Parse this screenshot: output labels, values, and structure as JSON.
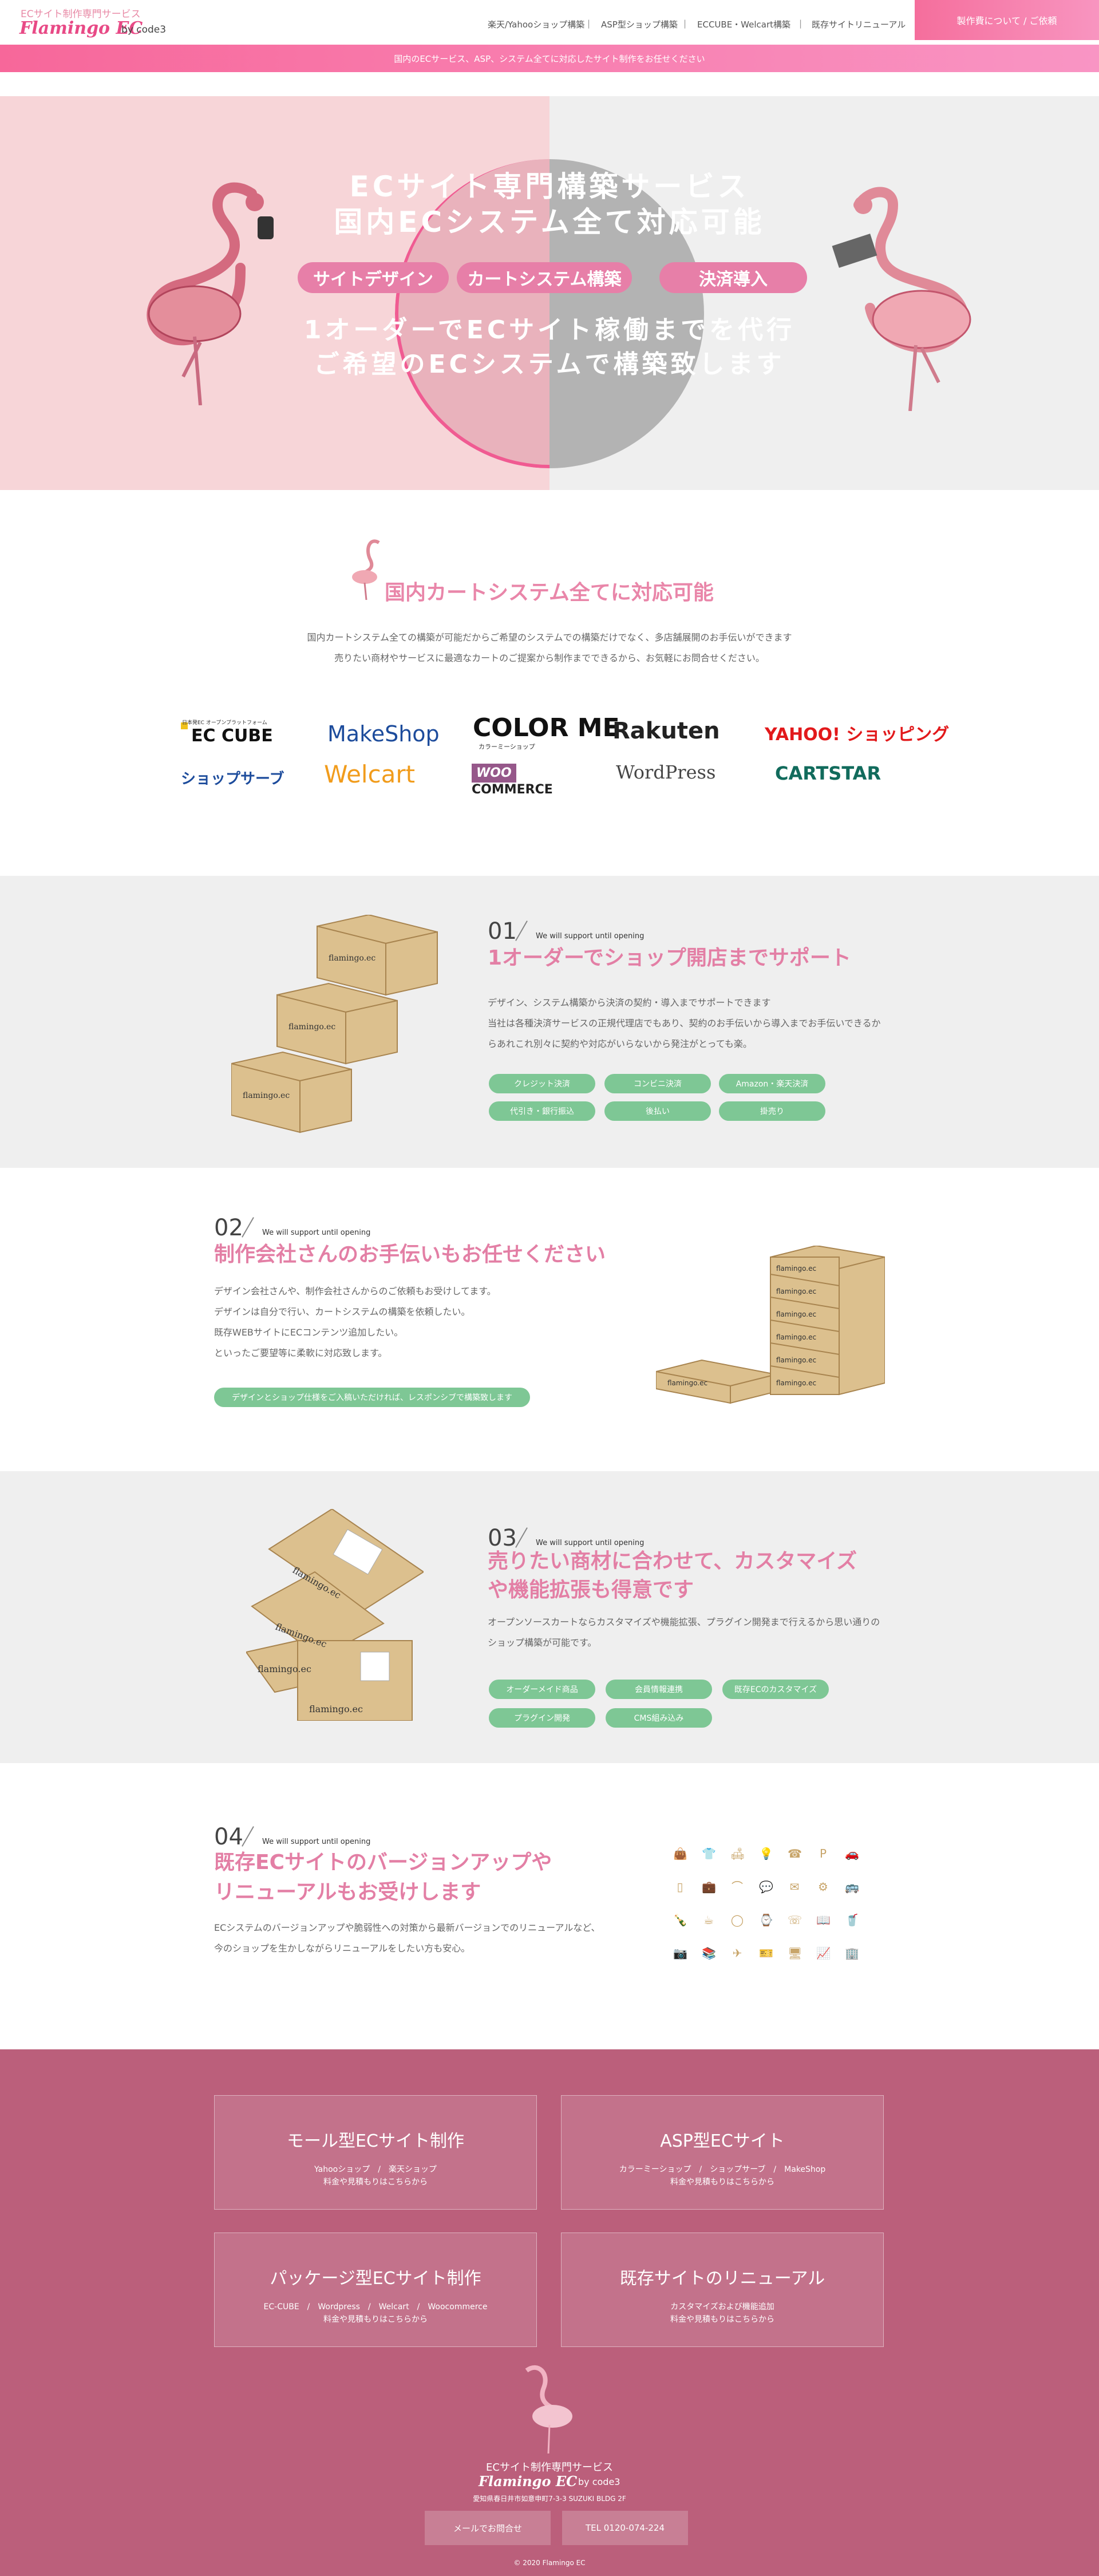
{
  "header": {
    "logo_sub": "ECサイト制作専門サービス",
    "logo_main": "Flamingo EC",
    "logo_by": "by code3",
    "nav": [
      "楽天/Yahooショップ構築",
      "ASP型ショップ構築",
      "ECCUBE・Welcart構築",
      "既存サイトリニューアル"
    ],
    "cta": "製作費について / ご依頼"
  },
  "notice": "国内のECサービス、ASP、システム全てに対応したサイト制作をお任せください",
  "hero": {
    "line1": "ECサイト専門構築サービス",
    "line2": "国内ECシステム全て対応可能",
    "pills": [
      "サイトデザイン",
      "カートシステム構築",
      "決済導入"
    ],
    "line3": "1オーダーでECサイト稼働までを代行",
    "line4": "ご希望のECシステムで構築致します"
  },
  "cart": {
    "title": "国内カートシステム全てに対応可能",
    "desc1": "国内カートシステム全ての構築が可能だからご希望のシステムでの構築だけでなく、多店舗展開のお手伝いができます",
    "desc2": "売りたい商材やサービスに最適なカートのご提案から制作までできるから、お気軽にお問合せください。",
    "logos_row1": [
      "EC CUBE",
      "MakeShop",
      "COLOR ME",
      "Rakuten",
      "YAHOO! ショッピング"
    ],
    "logos_row2": [
      "ショップサーブ",
      "Welcart",
      "WOO COMMERCE",
      "WordPress",
      "CARTSTAR"
    ],
    "ec_cube_note": "日本発EC オープンプラットフォーム",
    "colorme_note": "カラーミーショップ"
  },
  "f1": {
    "num": "01",
    "sub": "We will support until opening",
    "title": "1オーダーでショップ開店までサポート",
    "p1": "デザイン、システム構築から決済の契約・導入までサポートできます",
    "p2": "当社は各種決済サービスの正規代理店でもあり、契約のお手伝いから導入までお手伝いできるか",
    "p3": "らあれこれ別々に契約や対応がいらないから発注がとっても楽。",
    "tags": [
      "クレジット決済",
      "コンビニ決済",
      "Amazon・楽天決済",
      "代引き・銀行振込",
      "後払い",
      "掛売り"
    ]
  },
  "f2": {
    "num": "02",
    "sub": "We will support until opening",
    "title": "制作会社さんのお手伝いもお任せください",
    "p1": "デザイン会社さんや、制作会社さんからのご依頼もお受けしてます。",
    "p2": "デザインは自分で行い、カートシステムの構築を依頼したい。",
    "p3": "既存WEBサイトにECコンテンツ追加したい。",
    "p4": "といったご要望等に柔軟に対応致します。",
    "tag": "デザインとショップ仕様をご入稿いただければ、レスポンシブで構築致します"
  },
  "f3": {
    "num": "03",
    "sub": "We will support until opening",
    "title1": "売りたい商材に合わせて、カスタマイズ",
    "title2": "や機能拡張も得意です",
    "p1": "オープンソースカートならカスタマイズや機能拡張、プラグイン開発まで行えるから思い通りの",
    "p2": "ショップ構築が可能です。",
    "tags": [
      "オーダーメイド商品",
      "会員情報連携",
      "既存ECのカスタマイズ",
      "プラグイン開発",
      "CMS組み込み"
    ]
  },
  "f4": {
    "num": "04",
    "sub": "We will support until opening",
    "title1": "既存ECサイトのバージョンアップや",
    "title2": "リニューアルもお受けします",
    "p1": "ECシステムのバージョンアップや脆弱性への対策から最新バージョンでのリニューアルなど、",
    "p2": "今のショップを生かしながらリニューアルをしたい方も安心。",
    "icons": [
      "bag-icon",
      "shirt-icon",
      "sofa-icon",
      "lamp-icon",
      "phone-icon",
      "parking-icon",
      "car-icon",
      "tablet-icon",
      "briefcase-icon",
      "necklace-icon",
      "chat-icon",
      "mail-icon",
      "gear-icon",
      "bus-icon",
      "bottle-icon",
      "cup-icon",
      "ring-icon",
      "watch-icon",
      "phone2-icon",
      "book-icon",
      "drink-icon",
      "camera-icon",
      "books-icon",
      "plane-icon",
      "ticket-icon",
      "monitor-icon",
      "chart-icon",
      "building-icon"
    ]
  },
  "footer": {
    "boxes": [
      {
        "title": "モール型ECサイト制作",
        "line1": "Yahooショップ　/　楽天ショップ",
        "line2": "料金や見積もりはこちらから"
      },
      {
        "title": "ASP型ECサイト",
        "line1": "カラーミーショップ　/　ショップサーブ　/　MakeShop",
        "line2": "料金や見積もりはこちらから"
      },
      {
        "title": "パッケージ型ECサイト制作",
        "line1": "EC-CUBE　/　Wordpress　/　Welcart　/　Woocommerce",
        "line2": "料金や見積もりはこちらから"
      },
      {
        "title": "既存サイトのリニューアル",
        "line1": "カスタマイズおよび機能追加",
        "line2": "料金や見積もりはこちらから"
      }
    ],
    "service": "ECサイト制作専門サービス",
    "brand": "Flamingo EC",
    "by": "by code3",
    "address": "愛知県春日井市如意申町7-3-3 SUZUKI BLDG 2F",
    "btn_mail": "メールでお問合せ",
    "btn_tel": "TEL 0120-074-224",
    "copyright": "© 2020 Flamingo EC"
  },
  "colors": {
    "accent": "#e986a9",
    "brand": "#e84a86",
    "green": "#7ec795",
    "footer": "#bb5f7b"
  }
}
